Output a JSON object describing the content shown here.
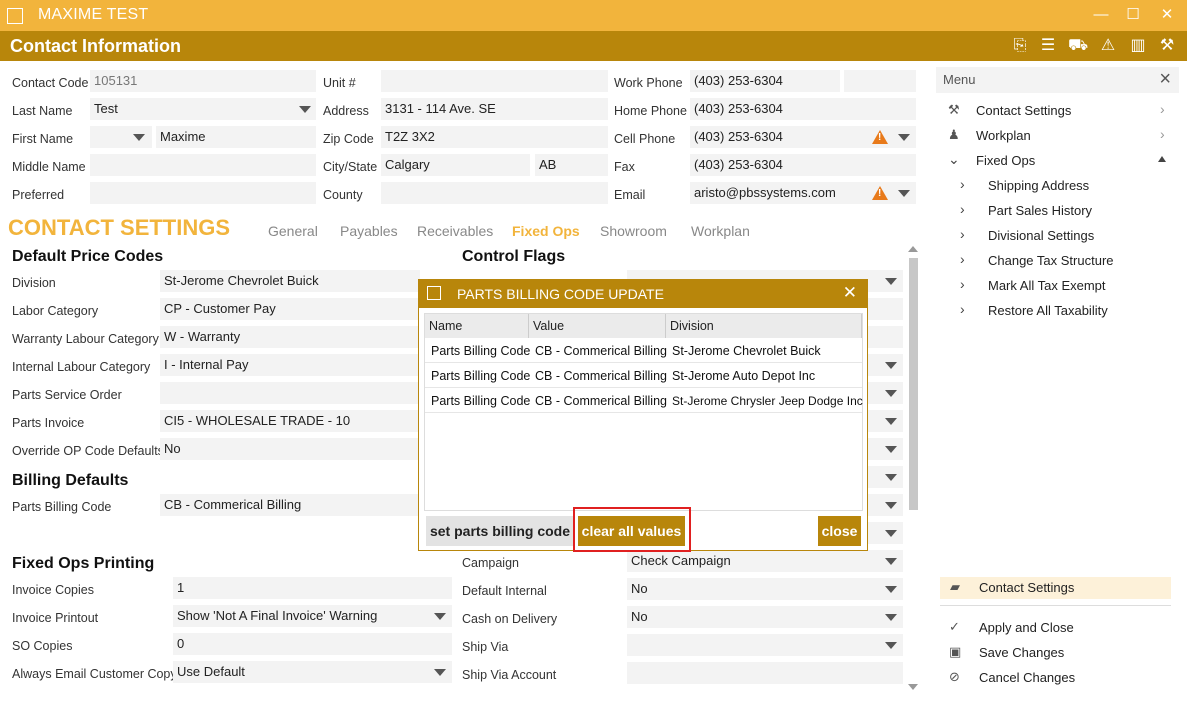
{
  "window": {
    "app_name": "MAXIME TEST",
    "minimize": "—",
    "maximize": "☐",
    "close": "✕"
  },
  "header": {
    "title": "Contact Information"
  },
  "contact": {
    "contact_code_label": "Contact Code",
    "contact_code": "105131",
    "last_name_label": "Last Name",
    "last_name": "Test",
    "first_name_label": "First Name",
    "first_name": "Maxime",
    "middle_name_label": "Middle Name",
    "preferred_label": "Preferred",
    "unit_label": "Unit #",
    "address_label": "Address",
    "address": "3131 - 114 Ave. SE",
    "zip_label": "Zip Code",
    "zip": "T2Z 3X2",
    "city_label": "City/State",
    "city": "Calgary",
    "state": "AB",
    "county_label": "County",
    "work_phone_label": "Work Phone",
    "work_phone": "(403) 253-6304",
    "home_phone_label": "Home Phone",
    "home_phone": "(403) 253-6304",
    "cell_phone_label": "Cell Phone",
    "cell_phone": "(403) 253-6304",
    "fax_label": "Fax",
    "fax": "(403) 253-6304",
    "email_label": "Email",
    "email": "aristo@pbssystems.com"
  },
  "settings": {
    "title": "CONTACT SETTINGS",
    "tabs": [
      "General",
      "Payables",
      "Receivables",
      "Fixed Ops",
      "Showroom",
      "Workplan"
    ],
    "default_price_codes": "Default Price Codes",
    "control_flags": "Control Flags",
    "division_label": "Division",
    "division": "St-Jerome Chevrolet Buick",
    "labor_label": "Labor Category",
    "labor": "CP - Customer Pay",
    "warranty_label": "Warranty Labour Category",
    "warranty": "W - Warranty",
    "internal_label": "Internal Labour Category",
    "internal": "I - Internal Pay",
    "pso_label": "Parts Service Order",
    "invoice_label": "Parts Invoice",
    "invoice": "CI5 - WHOLESALE TRADE - 10",
    "override_label": "Override OP Code Defaults",
    "override": "No",
    "billing_defaults": "Billing Defaults",
    "billing_label": "Parts Billing Code",
    "billing": "CB - Commerical Billing",
    "printing": "Fixed Ops Printing",
    "copies_label": "Invoice Copies",
    "copies": "1",
    "printout_label": "Invoice Printout",
    "printout": "Show 'Not A Final Invoice' Warning",
    "so_label": "SO Copies",
    "so": "0",
    "email_copy_label": "Always Email Customer Copy",
    "email_copy": "Use Default",
    "campaign_label": "Campaign",
    "campaign": "Check Campaign",
    "def_internal_label": "Default Internal",
    "def_internal": "No",
    "cod_label": "Cash on Delivery",
    "cod": "No",
    "ship_via_label": "Ship Via",
    "ship_acct_label": "Ship Via Account"
  },
  "modal": {
    "title": "PARTS BILLING CODE UPDATE",
    "columns": [
      "Name",
      "Value",
      "Division"
    ],
    "rows": [
      [
        "Parts Billing Code",
        "CB - Commerical Billing",
        "St-Jerome Chevrolet Buick"
      ],
      [
        "Parts Billing Code",
        "CB - Commerical Billing",
        "St-Jerome Auto Depot Inc"
      ],
      [
        "Parts Billing Code",
        "CB - Commerical Billing",
        "St-Jerome Chrysler Jeep Dodge Inc"
      ]
    ],
    "set_btn": "set parts billing code",
    "clear_btn": "clear all values",
    "close_btn": "close"
  },
  "menu": {
    "title": "Menu",
    "items": [
      "Contact Settings",
      "Workplan",
      "Fixed Ops"
    ],
    "sub_items": [
      "Shipping Address",
      "Part Sales History",
      "Divisional Settings",
      "Change Tax Structure",
      "Mark All Tax Exempt",
      "Restore All Taxability"
    ],
    "active": "Contact Settings",
    "actions": [
      "Apply and Close",
      "Save Changes",
      "Cancel Changes"
    ]
  },
  "colors": {
    "accent": "#f2b43c",
    "header": "#b8860b",
    "highlight": "#e02020"
  }
}
